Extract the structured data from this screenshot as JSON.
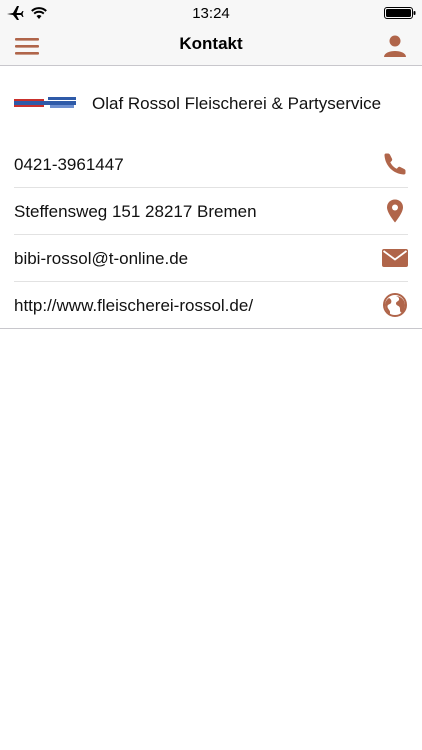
{
  "status_bar": {
    "time": "13:24",
    "icons": [
      "airplane-icon",
      "wifi-icon",
      "battery-icon"
    ]
  },
  "nav": {
    "title": "Kontakt",
    "left_icon": "hamburger-menu-icon",
    "right_icon": "user-icon"
  },
  "company": {
    "name": "Olaf Rossol Fleischerei & Partyservice",
    "logo_icon": "company-logo"
  },
  "contacts": [
    {
      "text": "0421-3961447",
      "icon": "phone-icon"
    },
    {
      "text": "Steffensweg 151 28217 Bremen",
      "icon": "location-pin-icon"
    },
    {
      "text": "bibi-rossol@t-online.de",
      "icon": "mail-icon"
    },
    {
      "text": "http://www.fleischerei-rossol.de/",
      "icon": "globe-icon"
    }
  ],
  "colors": {
    "accent": "#b0654a",
    "bar_background": "#f7f7f7",
    "separator": "#e2e2e2"
  }
}
